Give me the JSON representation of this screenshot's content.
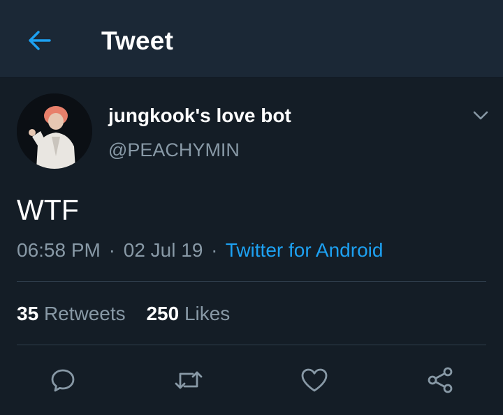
{
  "header": {
    "title": "Tweet",
    "back_icon": "arrow-left-icon"
  },
  "tweet": {
    "display_name": "jungkook's love bot",
    "handle": "@PEACHYMIN",
    "text": "WTF",
    "time": "06:58 PM",
    "date": "02 Jul 19",
    "separator": "·",
    "source": "Twitter for Android",
    "retweets_count": "35",
    "retweets_label": "Retweets",
    "likes_count": "250",
    "likes_label": "Likes"
  },
  "actions": [
    {
      "icon": "reply-icon"
    },
    {
      "icon": "retweet-icon"
    },
    {
      "icon": "like-icon"
    },
    {
      "icon": "share-icon"
    }
  ],
  "colors": {
    "background": "#141d26",
    "header": "#1b2836",
    "accent": "#1da1f2",
    "secondary_text": "#8899a6",
    "divider": "#2f3d4b"
  }
}
